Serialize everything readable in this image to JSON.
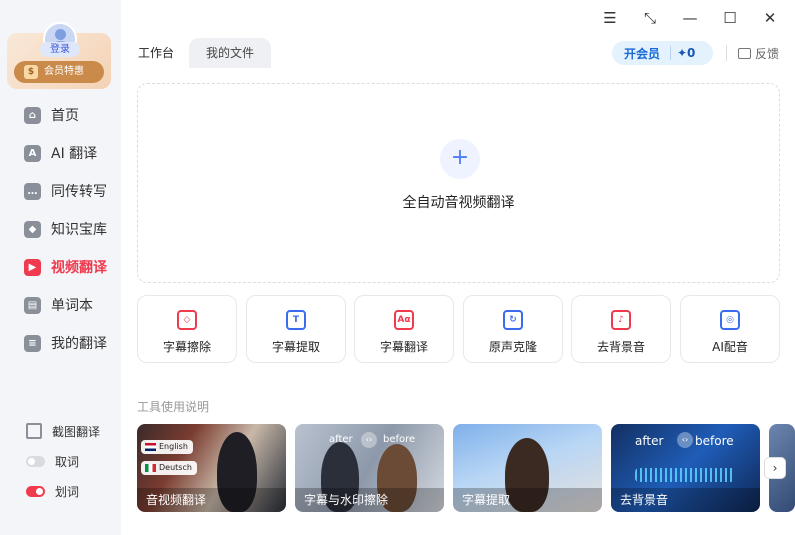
{
  "sidebar": {
    "login_label": "登录",
    "vip_label": "会员特惠",
    "vip_icon": "$",
    "nav": [
      {
        "label": "首页",
        "icon": "home-icon",
        "glyph": "⌂",
        "active": false
      },
      {
        "label": "AI 翻译",
        "icon": "ai-translate-icon",
        "glyph": "A",
        "active": false
      },
      {
        "label": "同传转写",
        "icon": "transcribe-icon",
        "glyph": "…",
        "active": false
      },
      {
        "label": "知识宝库",
        "icon": "knowledge-icon",
        "glyph": "◆",
        "active": false
      },
      {
        "label": "视频翻译",
        "icon": "video-icon",
        "glyph": "▶",
        "active": true
      },
      {
        "label": "单词本",
        "icon": "wordbook-icon",
        "glyph": "▤",
        "active": false
      },
      {
        "label": "我的翻译",
        "icon": "my-translation-icon",
        "glyph": "≡",
        "active": false
      }
    ],
    "tools": [
      {
        "label": "截图翻译"
      },
      {
        "label": "取词"
      },
      {
        "label": "划词"
      }
    ]
  },
  "window": {
    "menu": "☰",
    "mini": "⤡",
    "minimize": "—",
    "maximize": "☐",
    "close": "✕"
  },
  "header": {
    "tabs": [
      {
        "label": "工作台",
        "active": true
      },
      {
        "label": "我的文件",
        "active": false
      }
    ],
    "vip_open": "开会员",
    "points": "✦0",
    "feedback": "反馈"
  },
  "main": {
    "upload_label": "全自动音视频翻译",
    "upload_plus": "+",
    "tools": [
      {
        "label": "字幕擦除",
        "icon": "eraser-icon",
        "glyph": "◇",
        "color": "red"
      },
      {
        "label": "字幕提取",
        "icon": "extract-icon",
        "glyph": "T",
        "color": "blue"
      },
      {
        "label": "字幕翻译",
        "icon": "subtitle-translate-icon",
        "glyph": "Aα",
        "color": "red"
      },
      {
        "label": "原声克隆",
        "icon": "voice-clone-icon",
        "glyph": "↻",
        "color": "blue"
      },
      {
        "label": "去背景音",
        "icon": "remove-bg-music-icon",
        "glyph": "♪",
        "color": "red"
      },
      {
        "label": "AI配音",
        "icon": "ai-dubbing-icon",
        "glyph": "◎",
        "color": "blue"
      }
    ],
    "guide_title": "工具使用说明",
    "guide_cards": [
      {
        "caption": "音视频翻译",
        "badges": [
          "English",
          "Deutsch"
        ]
      },
      {
        "caption": "字幕与水印擦除",
        "after": "after",
        "before": "before"
      },
      {
        "caption": "字幕提取"
      },
      {
        "caption": "去背景音",
        "after": "after",
        "before": "before"
      }
    ],
    "next_arrow": "›"
  },
  "colors": {
    "accent_red": "#f03a4e",
    "accent_blue": "#3b6cf0",
    "vip_gold": "#c98a4a"
  }
}
